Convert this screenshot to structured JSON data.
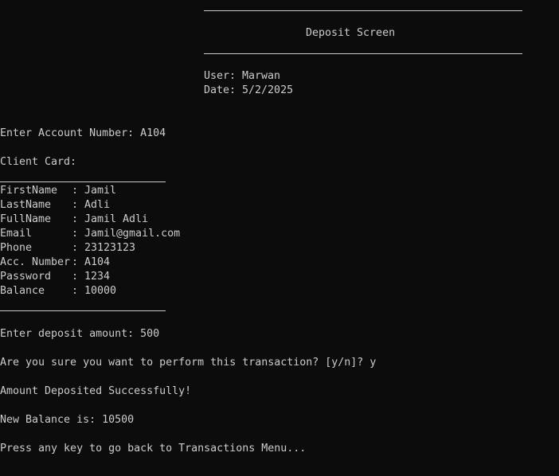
{
  "header": {
    "title": "Deposit Screen",
    "user_line": "User: Marwan",
    "date_line": "Date: 5/2/2025"
  },
  "prompts": {
    "account_number": "Enter Account Number: A104",
    "client_card_title": "Client Card:"
  },
  "client_card": {
    "fields": [
      {
        "label": "FirstName",
        "value": ": Jamil"
      },
      {
        "label": "LastName",
        "value": ": Adli"
      },
      {
        "label": "FullName",
        "value": ": Jamil Adli"
      },
      {
        "label": "Email",
        "value": ": Jamil@gmail.com"
      },
      {
        "label": "Phone",
        "value": ": 23123123"
      },
      {
        "label": "Acc. Number",
        "value": ": A104"
      },
      {
        "label": "Password",
        "value": ": 1234"
      },
      {
        "label": "Balance",
        "value": ": 10000"
      }
    ]
  },
  "transaction": {
    "deposit_prompt": "Enter deposit amount: 500",
    "confirm_prompt": "Are you sure you want to perform this transaction? [y/n]? y",
    "success_message": "Amount Deposited Successfully!",
    "new_balance": "New Balance is: 10500",
    "continue_prompt": "Press any key to go back to Transactions Menu..."
  }
}
